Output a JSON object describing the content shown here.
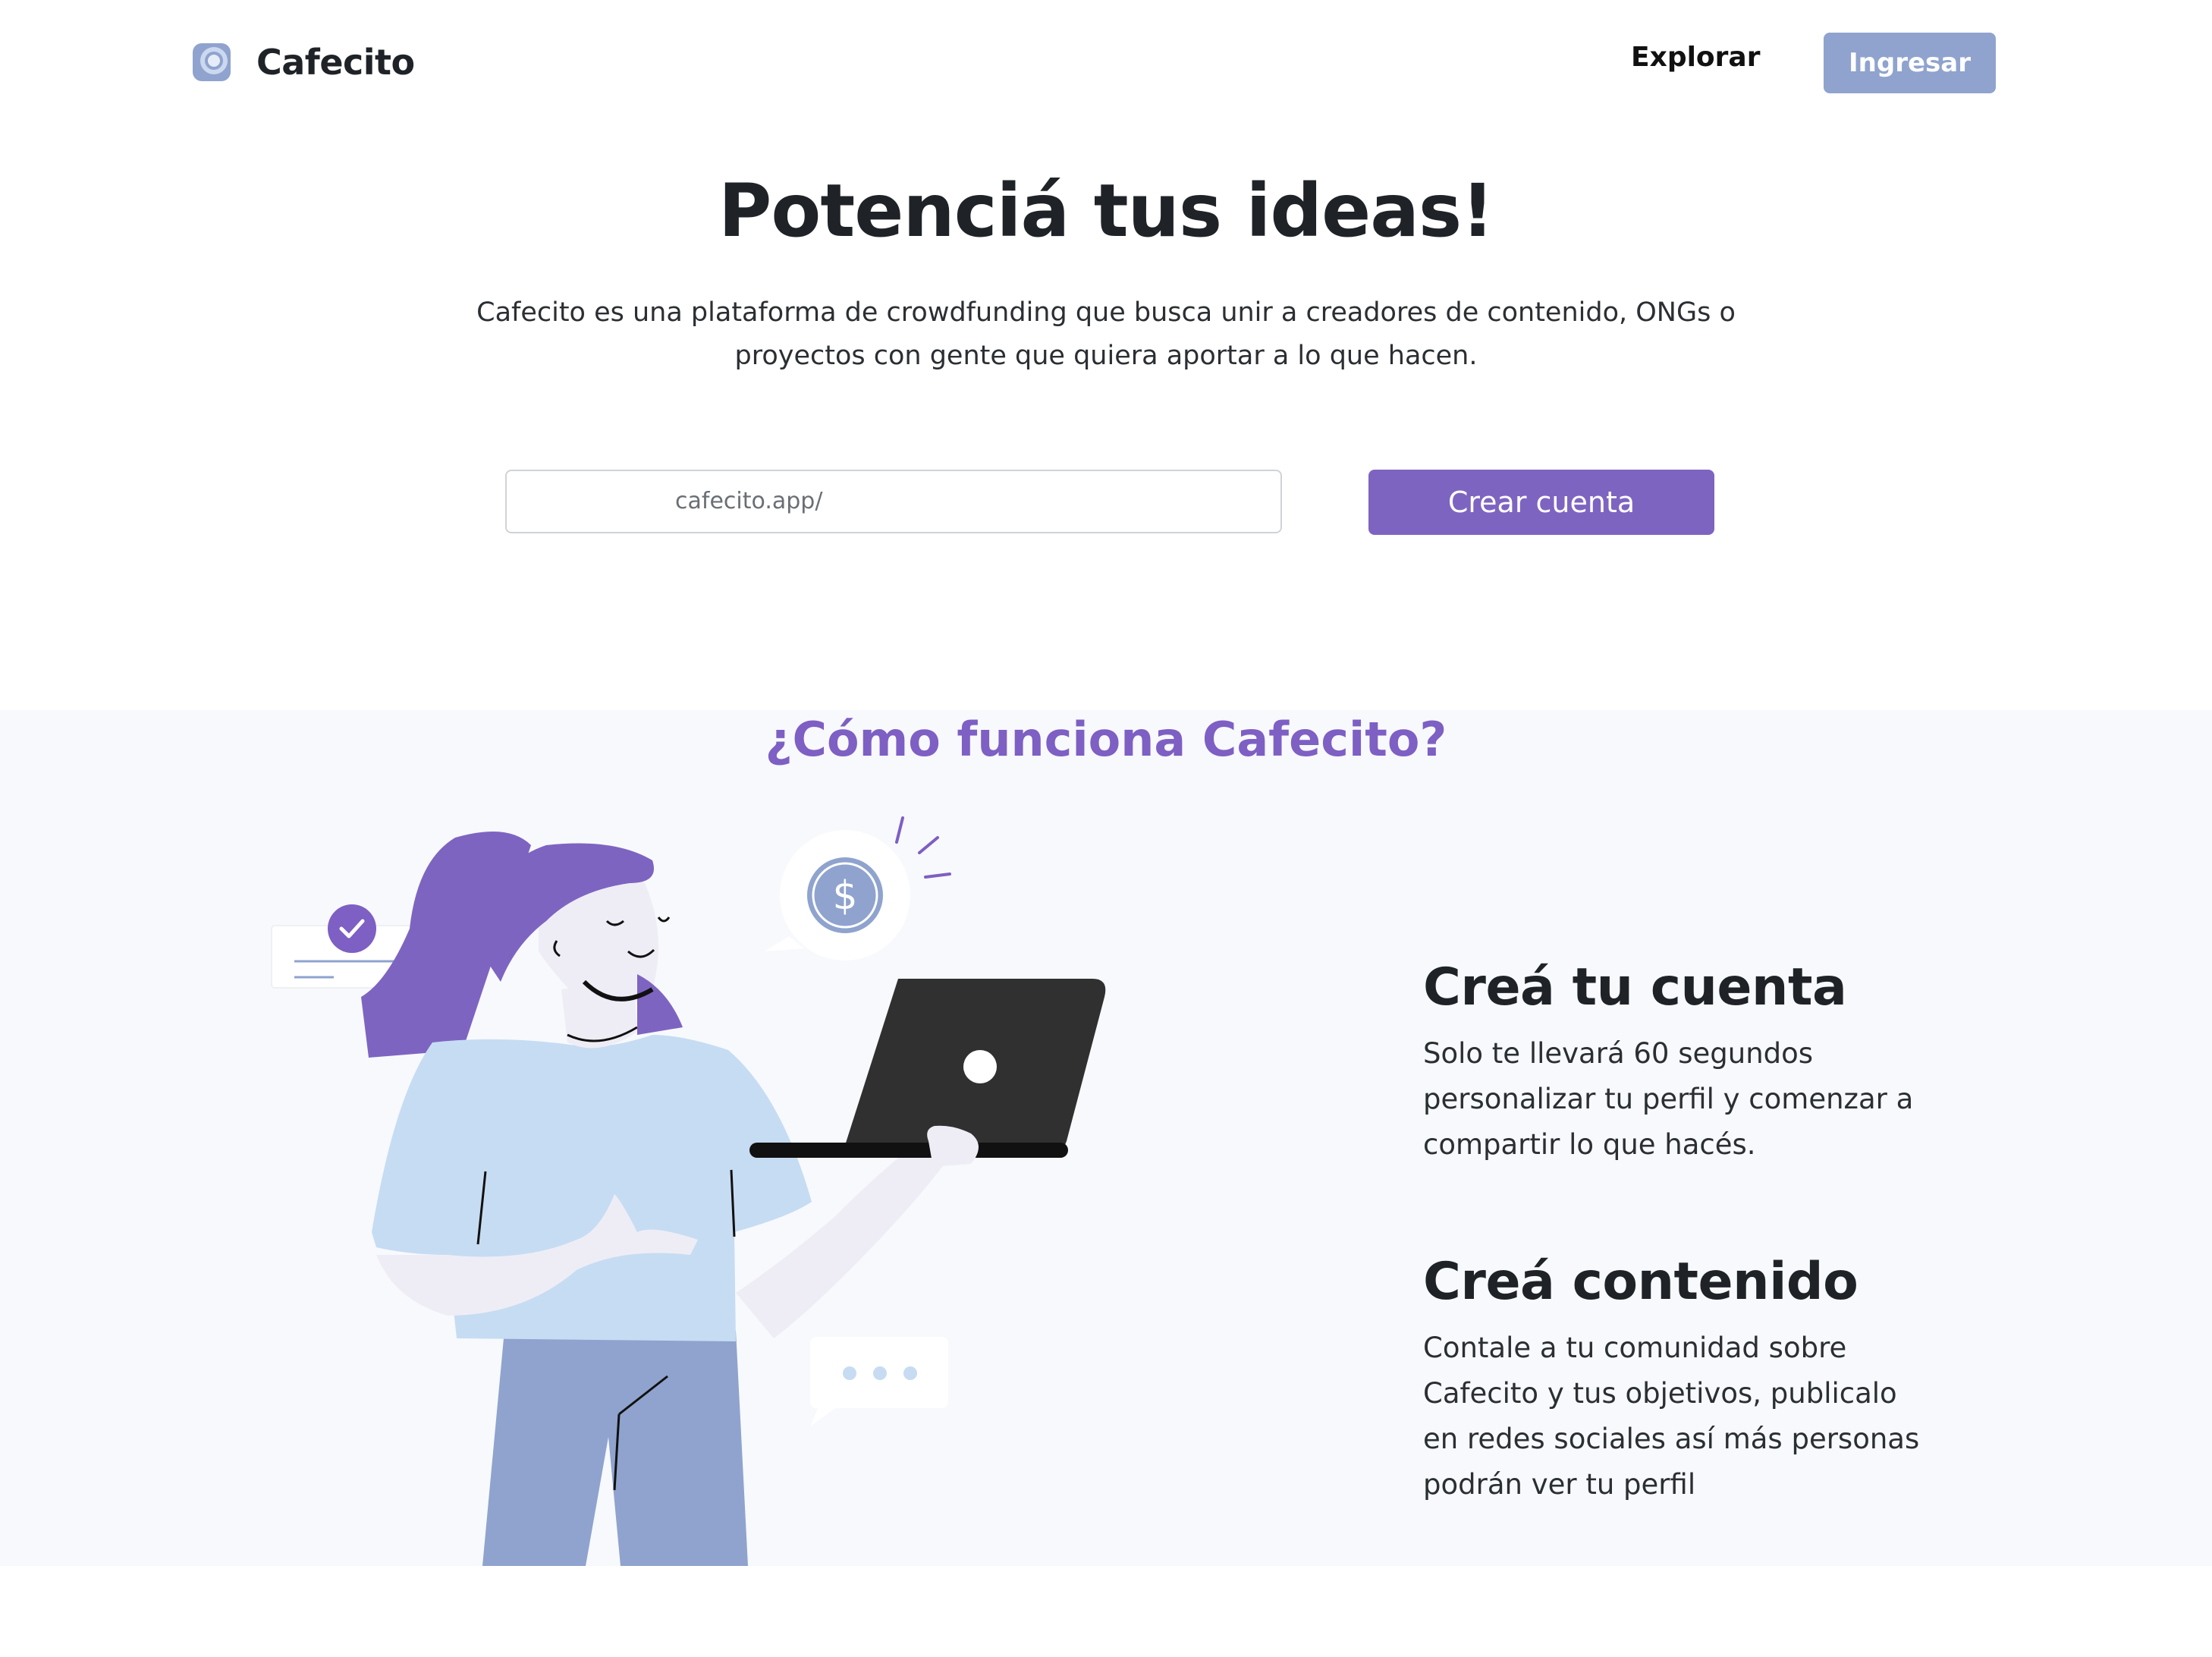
{
  "navbar": {
    "brand_name": "Cafecito",
    "logo_icon": "coffee-cup-logo-icon",
    "explore_link": "Explorar",
    "login_button": "Ingresar"
  },
  "hero": {
    "title": "Potenciá tus ideas!",
    "description": "Cafecito es una plataforma de crowdfunding que busca unir a creadores de contenido, ONGs o proyectos con gente que quiera aportar a lo que hacen.",
    "url_prefix": "cafecito.app/",
    "url_input_value": "",
    "create_account_button": "Crear cuenta"
  },
  "how_it_works": {
    "title": "¿Cómo funciona Cafecito?",
    "illustration": "woman-with-laptop-illustration",
    "steps": [
      {
        "title": "Creá tu cuenta",
        "text": "Solo te llevará 60 segundos\npersonalizar tu perfil y comenzar a\ncompartir lo que hacés."
      },
      {
        "title": "Creá contenido",
        "text": "Contale a tu comunidad sobre\nCafecito y tus objetivos, publicalo\nen redes sociales así más personas\npodrán ver tu perfil"
      }
    ]
  },
  "colors": {
    "accent_purple": "#7e64c1",
    "login_button_blue": "#8fa3ce",
    "section_background": "#f7f9fc"
  }
}
